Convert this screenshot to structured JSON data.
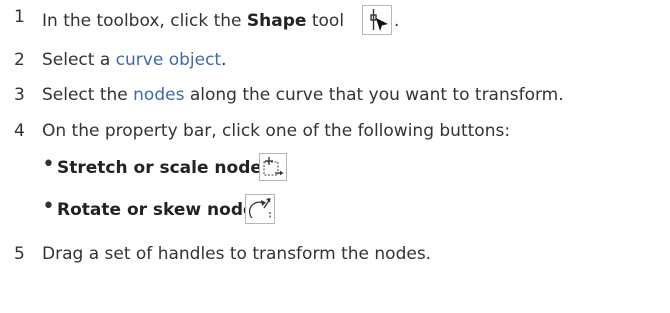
{
  "steps": [
    {
      "num": "1",
      "pre": "In the toolbox, click the ",
      "bold": "Shape",
      "post": " tool",
      "end": "."
    },
    {
      "num": "2",
      "pre": "Select a ",
      "link": "curve object",
      "post": "."
    },
    {
      "num": "3",
      "pre": "Select the ",
      "link": "nodes",
      "post": " along the curve that you want to transform."
    },
    {
      "num": "4",
      "text": "On the property bar, click one of the following buttons:"
    },
    {
      "num": "5",
      "text": "Drag a set of handles to transform the nodes."
    }
  ],
  "bullets": [
    {
      "mark": "•",
      "label": "Stretch or scale nodes",
      "icon": "stretch-scale-nodes-icon"
    },
    {
      "mark": "•",
      "label": "Rotate or skew nodes",
      "icon": "rotate-skew-nodes-icon"
    }
  ],
  "icons": {
    "shape_tool": "shape-tool-icon"
  }
}
